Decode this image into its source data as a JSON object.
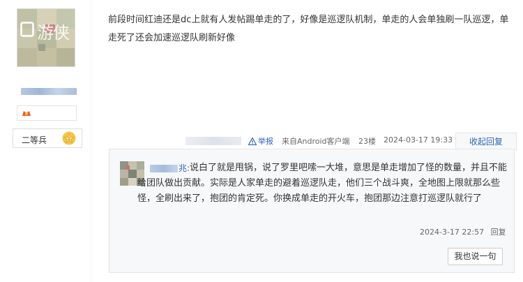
{
  "author": {
    "avatar_watermark": "游侠",
    "rank": "二等兵"
  },
  "post": {
    "body": "前段时间红迪还是dc上就有人发帖踢单走的了，好像是巡逻队机制，单走的人会单独刷一队巡逻，单走死了还会加速巡逻队刷新好像"
  },
  "meta": {
    "report_label": "举报",
    "source": "来自Android客户端",
    "floor": "23楼",
    "date": "2024-03-17 19:33",
    "collapse_label": "收起回复"
  },
  "reply": {
    "name_suffix": "兆:",
    "text": "说白了就是甩锅，说了罗里吧嗦一大堆，意思是单走增加了怪的数量，并且不能给团队做出贡献。实际是人家单走的避着巡逻队走，他们三个战斗爽，全地图上限就那么些怪，全刷出来了，抱团的肯定死。你换成单走的开火车，抱团那边注意打巡逻队就行了",
    "time": "2024-3-17 22:57",
    "reply_label": "回复"
  },
  "say_button": "我也说一句",
  "colors": {
    "link": "#2d64b3",
    "text": "#333333",
    "reply_bg": "#f7f8fa"
  }
}
